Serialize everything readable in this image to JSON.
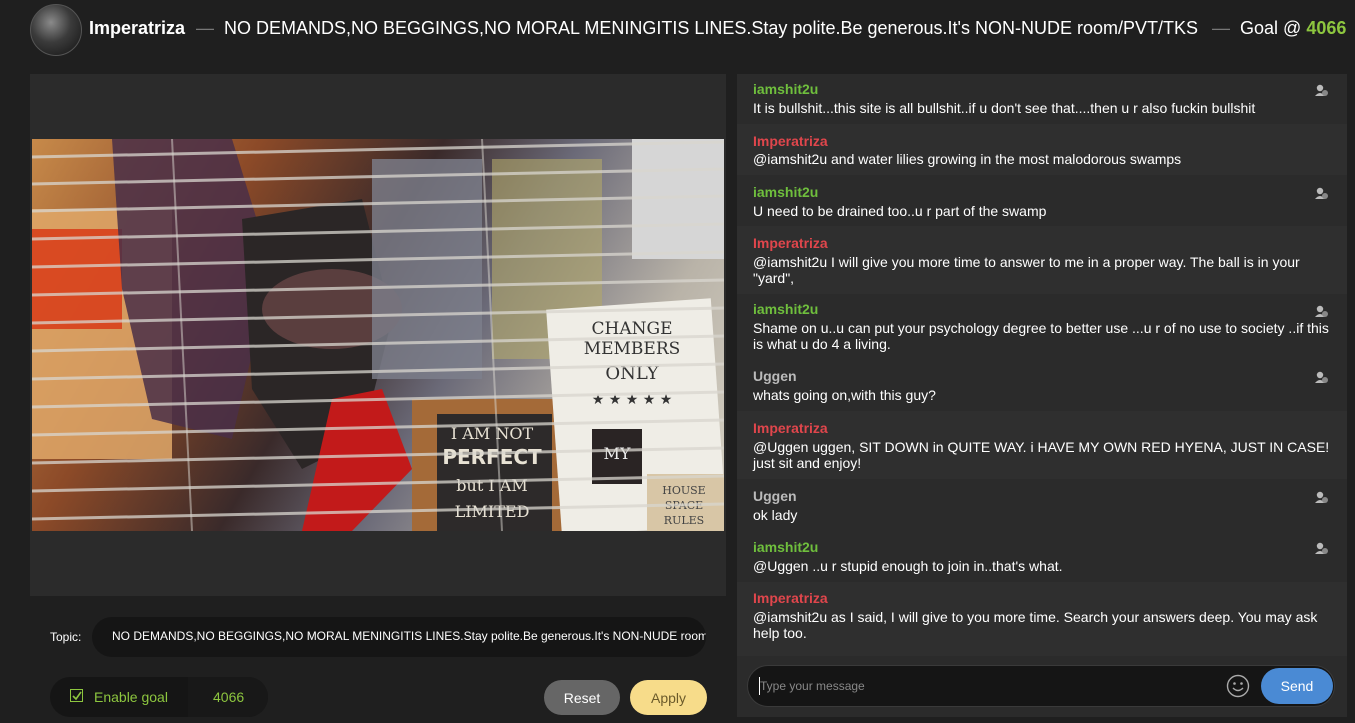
{
  "header": {
    "username": "Imperatriza",
    "separator": "—",
    "topic": "NO DEMANDS,NO BEGGINGS,NO MORAL MENINGITIS LINES.Stay polite.Be generous.It's NON-NUDE room/PVT/TKS",
    "goal_label": "Goal @",
    "goal_value": "4066",
    "goal_color": "#8dc63f"
  },
  "video": {
    "sign_text": "CHANGE MEMBERS ONLY",
    "sign_stars": "★ ★ ★ ★ ★",
    "sign2_line1": "I AM NOT",
    "sign2_line2": "PERFECT",
    "sign2_line3": "but I AM",
    "sign2_line4": "LIMITED",
    "sign3_text": "MY",
    "sign4_text": "HOUSE SPACE RULES"
  },
  "topic_row": {
    "label": "Topic:",
    "value": "NO DEMANDS,NO BEGGINGS,NO MORAL MENINGITIS LINES.Stay polite.Be generous.It's NON-NUDE room/PVT/TKS"
  },
  "goal_row": {
    "checkbox_label": "Enable goal",
    "value": "4066",
    "reset_label": "Reset",
    "apply_label": "Apply"
  },
  "chat": {
    "messages": [
      {
        "user": "iamshit2u",
        "text": "It is bullshit...this site is all bullshit..if u don't see that....then u r also fuckin bullshit"
      },
      {
        "user": "Imperatriza",
        "text": "@iamshit2u and water lilies growing in the most malodorous swamps"
      },
      {
        "user": "iamshit2u",
        "text": "U need to be drained too..u r part of the swamp"
      },
      {
        "user": "Imperatriza",
        "text": "@iamshit2u I will give you more time to answer to me in a proper way. The ball is in your \"yard\","
      },
      {
        "user": "iamshit2u",
        "text": "Shame on u..u can put your psychology degree to better use ...u r of no use to society ..if this is what u do 4 a living."
      },
      {
        "user": "Uggen",
        "text": "whats going on,with this guy?"
      },
      {
        "user": "Imperatriza",
        "text": "@Uggen uggen, SIT DOWN in QUITE WAY. i HAVE MY OWN RED HYENA, JUST IN CASE! just sit and enjoy!"
      },
      {
        "user": "Uggen",
        "text": "ok lady"
      },
      {
        "user": "iamshit2u",
        "text": "@Uggen ..u r stupid enough to join in..that's what."
      },
      {
        "user": "Imperatriza",
        "text": "@iamshit2u as I said, I will give to you more time. Search your answers deep. You may ask help too."
      }
    ],
    "input_placeholder": "Type your message",
    "send_label": "Send"
  },
  "colors": {
    "green_user": "#6fbf3d",
    "red_user": "#e0464c",
    "gray_user": "#bbbbbb",
    "send_button": "#4a8ad4",
    "apply_button": "#f7dc8a"
  }
}
